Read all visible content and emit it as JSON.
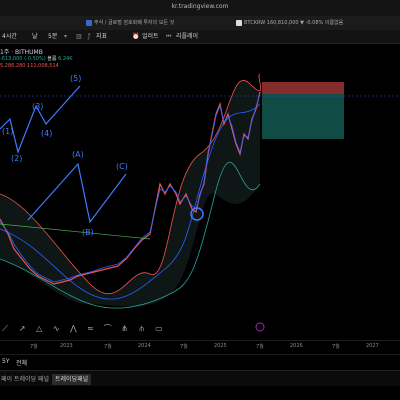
{
  "browser": {
    "url": "kr.tradingview.com",
    "tabs": [
      {
        "label": "주식 / 글로벌 암호화폐 투자의 모든 것"
      },
      {
        "label": "BTCKRW 160,810,000 ▼ -0.08% 이름없음"
      }
    ]
  },
  "toolbar": {
    "interval_4h": "4시간",
    "interval_day": "날",
    "interval_5m": "5분",
    "indicator": "지표",
    "alert": "얼러트",
    "replay": "리플레이"
  },
  "symbol": {
    "name": "1주 · BITHUMB",
    "change": "-613,000 (-0.50%)",
    "volume_label": "볼륨",
    "volume_value": "6.24K",
    "price_line": "5,286,280  111,008,514"
  },
  "wave_labels": [
    "(1)",
    "(2)",
    "(3)",
    "(4)",
    "(5)",
    "(A)",
    "(B)",
    "(C)"
  ],
  "time_axis": [
    "7월",
    "2023",
    "7월",
    "2024",
    "7월",
    "2025",
    "7월",
    "2026",
    "7월",
    "2027"
  ],
  "range_bar": {
    "range": "5Y",
    "all": "전체"
  },
  "panel_tabs": [
    "페이 트레이딩 패널",
    "트레이딩패널"
  ],
  "colors": {
    "up": "#26a69a",
    "down": "#ef5350",
    "band": "#ef5350",
    "mid": "#2962ff",
    "wave": "#3d7bff",
    "bg": "#000000"
  }
}
